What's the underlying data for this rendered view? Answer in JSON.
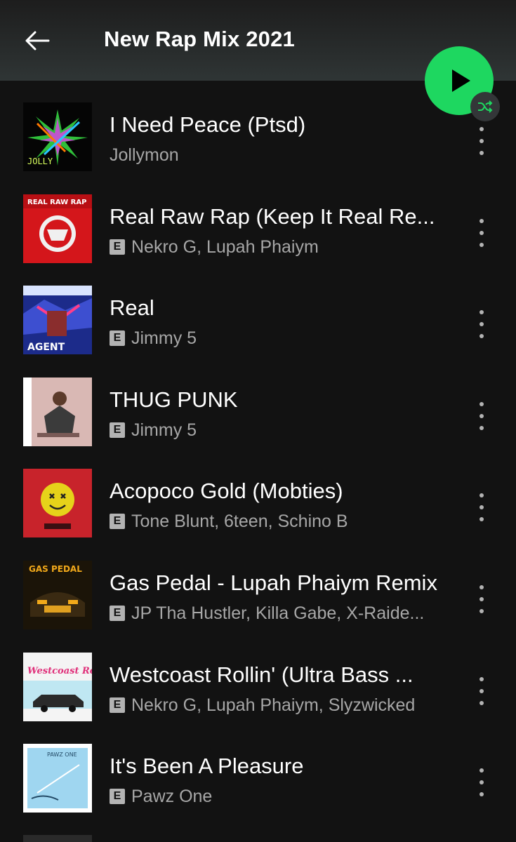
{
  "header": {
    "title": "New Rap Mix 2021",
    "back_icon": "arrow-left-icon",
    "play_icon": "play-icon",
    "shuffle_icon": "shuffle-icon",
    "accent_color": "#1ed760"
  },
  "tracks": [
    {
      "title": "I Need Peace (Ptsd)",
      "artists": "Jollymon",
      "explicit": false,
      "art_text": "JOLLY"
    },
    {
      "title": "Real Raw Rap (Keep It Real Re...",
      "artists": "Nekro G, Lupah Phaiym",
      "explicit": true,
      "art_text": "REAL RAW RAP"
    },
    {
      "title": "Real",
      "artists": "Jimmy 5",
      "explicit": true,
      "art_text": "AGENT"
    },
    {
      "title": "THUG PUNK",
      "artists": "Jimmy 5",
      "explicit": true,
      "art_text": ""
    },
    {
      "title": "Acopoco Gold (Mobties)",
      "artists": "Tone Blunt, 6teen, Schino B",
      "explicit": true,
      "art_text": ""
    },
    {
      "title": "Gas Pedal - Lupah Phaiym Remix",
      "artists": "JP Tha Hustler, Killa Gabe, X-Raide...",
      "explicit": true,
      "art_text": "GAS PEDAL"
    },
    {
      "title": "Westcoast Rollin' (Ultra Bass ...",
      "artists": "Nekro G, Lupah Phaiym, Slyzwicked",
      "explicit": true,
      "art_text": "Westcoast Rollin"
    },
    {
      "title": "It's Been A Pleasure",
      "artists": "Pawz One",
      "explicit": true,
      "art_text": "PAWZ ONE"
    }
  ],
  "explicit_label": "E",
  "more_icon": "more-vertical-icon"
}
